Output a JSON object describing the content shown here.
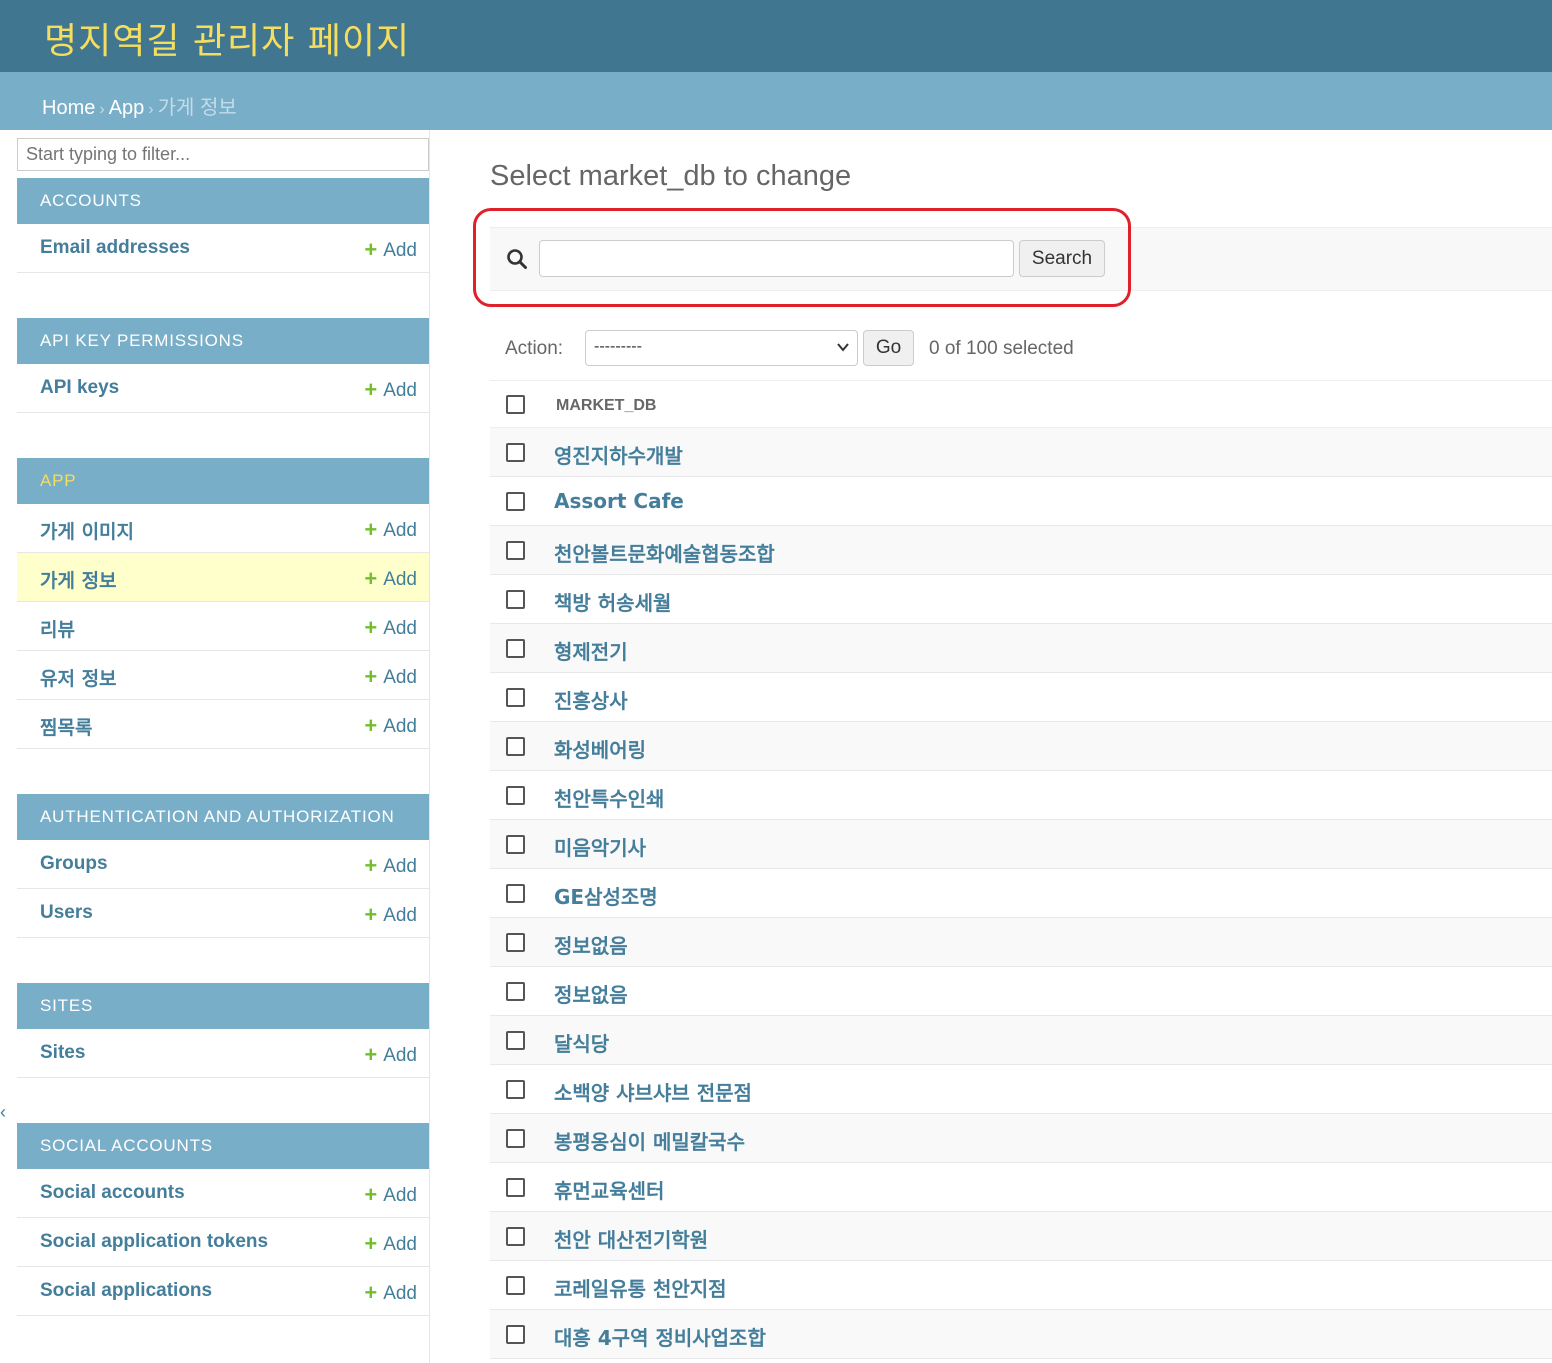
{
  "header": {
    "site_title": "명지역길 관리자 페이지"
  },
  "breadcrumbs": {
    "home": "Home",
    "app": "App",
    "current": "가게 정보",
    "separator": "›"
  },
  "sidebar": {
    "filter_placeholder": "Start typing to filter...",
    "collapse_glyph": "‹",
    "add_label": "Add",
    "modules": [
      {
        "caption": "ACCOUNTS",
        "models": [
          "Email addresses"
        ]
      },
      {
        "caption": "API KEY PERMISSIONS",
        "models": [
          "API keys"
        ]
      },
      {
        "caption": "APP",
        "models": [
          "가게 이미지",
          "가게 정보",
          "리뷰",
          "유저 정보",
          "찜목록"
        ]
      },
      {
        "caption": "AUTHENTICATION AND AUTHORIZATION",
        "models": [
          "Groups",
          "Users"
        ]
      },
      {
        "caption": "SITES",
        "models": [
          "Sites"
        ]
      },
      {
        "caption": "SOCIAL ACCOUNTS",
        "models": [
          "Social accounts",
          "Social application tokens",
          "Social applications"
        ]
      }
    ]
  },
  "content": {
    "title": "Select market_db to change",
    "search": {
      "value": "",
      "button": "Search"
    },
    "actions": {
      "label": "Action:",
      "selected_option": "---------",
      "go": "Go",
      "selection_count": "0 of 100 selected"
    },
    "table": {
      "column_header": "MARKET_DB",
      "rows": [
        "영진지하수개발",
        "Assort Cafe",
        "천안볼트문화예술협동조합",
        "책방 허송세월",
        "형제전기",
        "진흥상사",
        "화성베어링",
        "천안특수인쇄",
        "미음악기사",
        "GE삼성조명",
        "정보없음",
        "정보없음",
        "달식당",
        "소백양 샤브샤브 전문점",
        "봉평옹심이 메밀칼국수",
        "휴먼교육센터",
        "천안 대산전기학원",
        "코레일유통 천안지점",
        "대흥 4구역 정비사업조합"
      ]
    }
  },
  "colors": {
    "header_bg": "#417690",
    "breadcrumb_bg": "#79aec8",
    "title_yellow": "#f5dd5d",
    "link_blue": "#447e9b",
    "add_green": "#70bf2b",
    "current_row_bg": "#ffffcc",
    "highlight_red": "#e0202a"
  }
}
